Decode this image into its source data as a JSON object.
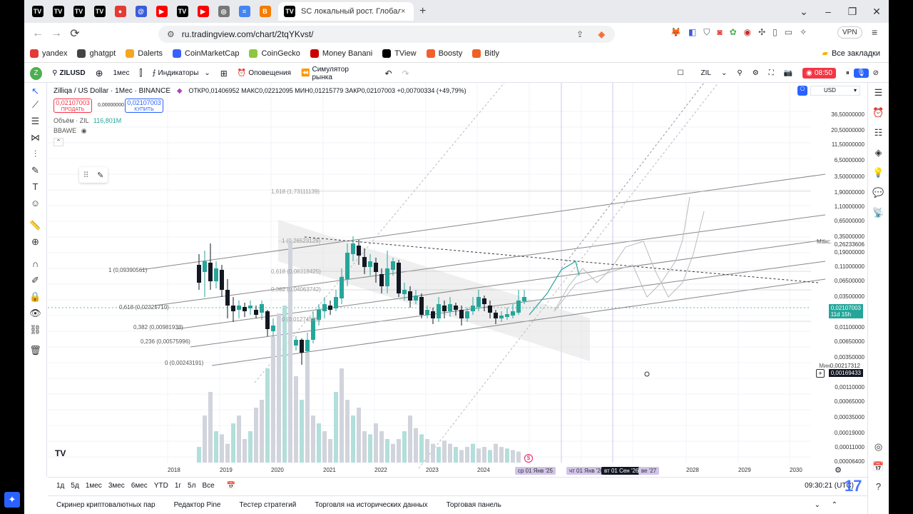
{
  "browser": {
    "tabs": [
      {
        "icon": "tradingview-icon",
        "color": "#000000"
      },
      {
        "icon": "tradingview-icon",
        "color": "#000000"
      },
      {
        "icon": "tradingview-icon",
        "color": "#000000"
      },
      {
        "icon": "tradingview-icon",
        "color": "#000000"
      },
      {
        "icon": "record-icon",
        "color": "#e53935"
      },
      {
        "icon": "email-icon",
        "color": "#3b5bdb"
      },
      {
        "icon": "youtube-icon",
        "color": "#ff0000"
      },
      {
        "icon": "tradingview-icon",
        "color": "#000000"
      },
      {
        "icon": "youtube-icon",
        "color": "#ff0000"
      },
      {
        "icon": "globe-icon",
        "color": "#777777"
      },
      {
        "icon": "docs-icon",
        "color": "#4285f4"
      },
      {
        "icon": "blogger-icon",
        "color": "#f57c00"
      }
    ],
    "active_tab_title": "SC локальный рост. Глобально в С",
    "new_tab": "+",
    "url": "ru.tradingview.com/chart/2tqYKvst/",
    "vpn": "VPN",
    "all_bookmarks": "Все закладки",
    "bookmarks": [
      {
        "label": "yandex",
        "color": "#e53935"
      },
      {
        "label": "ghatgpt",
        "color": "#444444"
      },
      {
        "label": "Dalerts",
        "color": "#f5a623"
      },
      {
        "label": "CoinMarketCap",
        "color": "#3861fb"
      },
      {
        "label": "CoinGecko",
        "color": "#8dc63f"
      },
      {
        "label": "Money Banani",
        "color": "#cc0000"
      },
      {
        "label": "TView",
        "color": "#000000"
      },
      {
        "label": "Boosty",
        "color": "#f15f2c"
      },
      {
        "label": "Bitly",
        "color": "#ee6123"
      }
    ]
  },
  "tv": {
    "symbol": "ZILUSD",
    "interval": "1мес",
    "indicators": "Индикаторы",
    "alerts": "Оповещения",
    "replay": "Симулятор рынка",
    "right_symbol": "ZIL",
    "rec_time": "08:50",
    "legend_title": "Zilliqa / US Dollar · 1Мес · BINANCE",
    "ohlc": "ОТКР0,01406952 МАКС0,02212095 МИН0,01215779 ЗАКР0,02107003 +0,00700334 (+49,79%)",
    "sell_price": "0,02107003",
    "sell_label": "ПРОДАТЬ",
    "spread": "0,00000000",
    "buy_price": "0,02107003",
    "buy_label": "КУПИТЬ",
    "volume_label": "Объём · ZIL",
    "volume_value": "116,801M",
    "bbawe": "BBAWE",
    "currency": "USD",
    "max_label": "Макс.",
    "min_label": "Мин.",
    "last_price": "0,02107003",
    "last_countdown": "11d 15h",
    "cross_price": "0,00169433",
    "min_price": "0,00217312",
    "price_ticks": [
      "36,50000000",
      "20,50000000",
      "11,50000000",
      "6,50000000",
      "3,50000000",
      "1,90000000",
      "1,10000000",
      "0,65000000",
      "0,35000000",
      "0,26233606",
      "0,19000000",
      "0,11000000",
      "0,06500000",
      "0,03500000",
      "0,01100000",
      "0,00650000",
      "0,00350000",
      "0,00110000",
      "0,00065000",
      "0,00035000",
      "0,00019000",
      "0,00011000",
      "0,00006400"
    ],
    "year_ticks": [
      "2018",
      "2019",
      "2020",
      "2021",
      "2022",
      "2023",
      "2024",
      "2028",
      "2029",
      "2030"
    ],
    "time_labels": [
      "ср 01 Янв '25",
      "чт 01 Янв '26",
      "вт 01 Сен '26",
      "ве '27"
    ],
    "fib_left": [
      "1 (0,09390561)",
      "0,618 (0,02325710)",
      "0,382 (0,00981938)",
      "0,236 (0,00575996)",
      "0 (0,00243191)"
    ],
    "fib_mid": [
      "1,618 (1,73111139)",
      "1 (0,26523129)",
      "0,618 (0,08318425)",
      "0,382 (0,04063742)",
      "0 (0,01274535)"
    ],
    "ranges": [
      "1д",
      "5д",
      "1мес",
      "3мес",
      "6мес",
      "YTD",
      "1г",
      "5л",
      "Все"
    ],
    "clock": "09:30:21 (UTC)",
    "bottom_tabs": [
      "Скринер криптовалютных пар",
      "Редактор Pine",
      "Тестер стратегий",
      "Торговля на исторических данных",
      "Торговая панель"
    ]
  }
}
